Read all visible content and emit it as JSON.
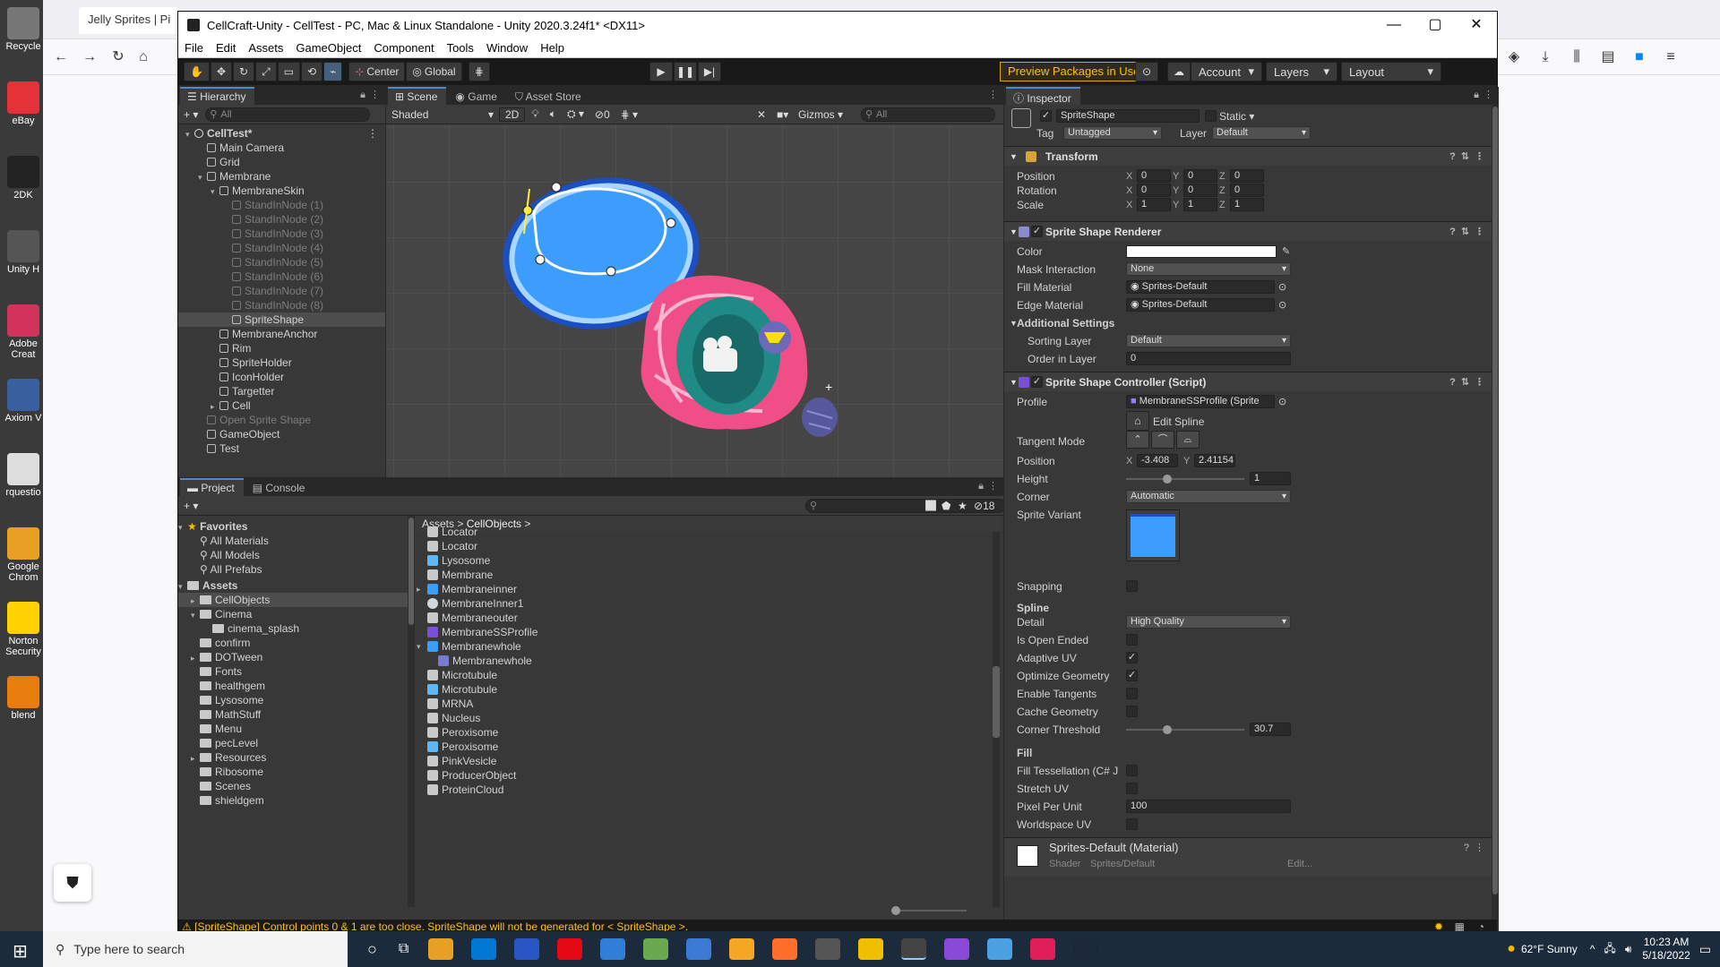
{
  "desktop": {
    "icons": [
      "Recycle",
      "eBay",
      "2DK",
      "Unity H",
      "Adobe Creat",
      "Axiom V",
      "rquestio",
      "Google Chrom",
      "Norton Security",
      "blend"
    ]
  },
  "browser": {
    "tab_title": "Jelly Sprites | Pi",
    "nav": {
      "back": "←",
      "forward": "→",
      "reload": "↻",
      "home": "⌂"
    }
  },
  "unity": {
    "title": "CellCraft-Unity - CellTest - PC, Mac & Linux Standalone - Unity 2020.3.24f1* <DX11>",
    "menu": [
      "File",
      "Edit",
      "Assets",
      "GameObject",
      "Component",
      "Tools",
      "Window",
      "Help"
    ],
    "toolbar": {
      "center": "Center",
      "global": "Global",
      "preview": "Preview Packages in Use",
      "account": "Account",
      "layers": "Layers",
      "layout": "Layout"
    },
    "hierarchy": {
      "tab": "Hierarchy",
      "search_placeholder": "All",
      "rows": [
        {
          "label": "CellTest*",
          "indent": 0,
          "arrow": "▾",
          "dim": false,
          "bold": true
        },
        {
          "label": "Main Camera",
          "indent": 1,
          "arrow": "",
          "dim": false
        },
        {
          "label": "Grid",
          "indent": 1,
          "arrow": "",
          "dim": false
        },
        {
          "label": "Membrane",
          "indent": 1,
          "arrow": "▾",
          "dim": false
        },
        {
          "label": "MembraneSkin",
          "indent": 2,
          "arrow": "▾",
          "dim": false
        },
        {
          "label": "StandInNode (1)",
          "indent": 3,
          "arrow": "",
          "dim": true
        },
        {
          "label": "StandInNode (2)",
          "indent": 3,
          "arrow": "",
          "dim": true
        },
        {
          "label": "StandInNode (3)",
          "indent": 3,
          "arrow": "",
          "dim": true
        },
        {
          "label": "StandInNode (4)",
          "indent": 3,
          "arrow": "",
          "dim": true
        },
        {
          "label": "StandInNode (5)",
          "indent": 3,
          "arrow": "",
          "dim": true
        },
        {
          "label": "StandInNode (6)",
          "indent": 3,
          "arrow": "",
          "dim": true
        },
        {
          "label": "StandInNode (7)",
          "indent": 3,
          "arrow": "",
          "dim": true
        },
        {
          "label": "StandInNode (8)",
          "indent": 3,
          "arrow": "",
          "dim": true
        },
        {
          "label": "SpriteShape",
          "indent": 3,
          "arrow": "",
          "dim": false,
          "selected": true
        },
        {
          "label": "MembraneAnchor",
          "indent": 2,
          "arrow": "",
          "dim": false
        },
        {
          "label": "Rim",
          "indent": 2,
          "arrow": "",
          "dim": false
        },
        {
          "label": "SpriteHolder",
          "indent": 2,
          "arrow": "",
          "dim": false
        },
        {
          "label": "IconHolder",
          "indent": 2,
          "arrow": "",
          "dim": false
        },
        {
          "label": "Targetter",
          "indent": 2,
          "arrow": "",
          "dim": false
        },
        {
          "label": "Cell",
          "indent": 2,
          "arrow": "▸",
          "dim": false
        },
        {
          "label": "Open Sprite Shape",
          "indent": 1,
          "arrow": "",
          "dim": true
        },
        {
          "label": "GameObject",
          "indent": 1,
          "arrow": "",
          "dim": false
        },
        {
          "label": "Test",
          "indent": 1,
          "arrow": "",
          "dim": false
        }
      ]
    },
    "scene": {
      "tabs": [
        "Scene",
        "Game",
        "Asset Store"
      ],
      "shading": "Shaded",
      "mode_2d": "2D",
      "hidden_count": "0",
      "gizmos": "Gizmos",
      "search_placeholder": "All"
    },
    "inspector": {
      "tab": "Inspector",
      "object_name": "SpriteShape",
      "static_label": "Static",
      "tag_label": "Tag",
      "tag_value": "Untagged",
      "layer_label": "Layer",
      "layer_value": "Default",
      "transform": {
        "title": "Transform",
        "rows": [
          {
            "label": "Position",
            "x": "0",
            "y": "0",
            "z": "0"
          },
          {
            "label": "Rotation",
            "x": "0",
            "y": "0",
            "z": "0"
          },
          {
            "label": "Scale",
            "x": "1",
            "y": "1",
            "z": "1"
          }
        ]
      },
      "renderer": {
        "title": "Sprite Shape Renderer",
        "color_label": "Color",
        "mask_label": "Mask Interaction",
        "mask_value": "None",
        "fill_label": "Fill Material",
        "fill_value": "Sprites-Default",
        "edge_label": "Edge Material",
        "edge_value": "Sprites-Default",
        "additional": "Additional Settings",
        "sorting_label": "Sorting Layer",
        "sorting_value": "Default",
        "order_label": "Order in Layer",
        "order_value": "0"
      },
      "controller": {
        "title": "Sprite Shape Controller (Script)",
        "profile_label": "Profile",
        "profile_value": "MembraneSSProfile (Sprite",
        "edit_spline": "Edit Spline",
        "tangent_label": "Tangent Mode",
        "position_label": "Position",
        "pos_x": "-3.408",
        "pos_y": "2.41154",
        "height_label": "Height",
        "height_value": "1",
        "height_slider": 0.35,
        "corner_label": "Corner",
        "corner_value": "Automatic",
        "variant_label": "Sprite Variant",
        "snapping_label": "Snapping",
        "spline_header": "Spline",
        "detail_label": "Detail",
        "detail_value": "High Quality",
        "open_ended_label": "Is Open Ended",
        "adaptive_label": "Adaptive UV",
        "optimize_label": "Optimize Geometry",
        "tangents_label": "Enable Tangents",
        "cache_label": "Cache Geometry",
        "threshold_label": "Corner Threshold",
        "threshold_value": "30.7",
        "threshold_slider": 0.35,
        "fill_header": "Fill",
        "tessellation_label": "Fill Tessellation (C# J",
        "stretch_label": "Stretch UV",
        "ppu_label": "Pixel Per Unit",
        "ppu_value": "100",
        "worldspace_label": "Worldspace UV",
        "checks": {
          "snapping": false,
          "open_ended": false,
          "adaptive": true,
          "optimize": true,
          "tangents": false,
          "cache": false,
          "tessellation": false,
          "stretch": false,
          "worldspace": false
        }
      },
      "material": {
        "title": "Sprites-Default (Material)",
        "shader_label": "Shader",
        "shader_value": "Sprites/Default",
        "edit": "Edit..."
      }
    },
    "project": {
      "tabs": [
        "Project",
        "Console"
      ],
      "hidden_count": "18",
      "favorites": {
        "label": "Favorites",
        "items": [
          "All Materials",
          "All Models",
          "All Prefabs"
        ]
      },
      "assets_label": "Assets",
      "folders": [
        {
          "label": "CellObjects",
          "indent": 1,
          "arrow": "▸",
          "selected": true
        },
        {
          "label": "Cinema",
          "indent": 1,
          "arrow": "▾"
        },
        {
          "label": "cinema_splash",
          "indent": 2,
          "arrow": ""
        },
        {
          "label": "confirm",
          "indent": 1,
          "arrow": ""
        },
        {
          "label": "DOTween",
          "indent": 1,
          "arrow": "▸"
        },
        {
          "label": "Fonts",
          "indent": 1,
          "arrow": ""
        },
        {
          "label": "healthgem",
          "indent": 1,
          "arrow": ""
        },
        {
          "label": "Lysosome",
          "indent": 1,
          "arrow": ""
        },
        {
          "label": "MathStuff",
          "indent": 1,
          "arrow": ""
        },
        {
          "label": "Menu",
          "indent": 1,
          "arrow": ""
        },
        {
          "label": "pecLevel",
          "indent": 1,
          "arrow": ""
        },
        {
          "label": "Resources",
          "indent": 1,
          "arrow": "▸"
        },
        {
          "label": "Ribosome",
          "indent": 1,
          "arrow": ""
        },
        {
          "label": "Scenes",
          "indent": 1,
          "arrow": ""
        },
        {
          "label": "shieldgem",
          "indent": 1,
          "arrow": ""
        }
      ],
      "breadcrumb": [
        "Assets",
        "CellObjects"
      ],
      "files": [
        {
          "label": "Locator",
          "kind": "script",
          "indent": 0
        },
        {
          "label": "Locator",
          "kind": "script",
          "indent": 0
        },
        {
          "label": "Lysosome",
          "kind": "prefab",
          "indent": 0
        },
        {
          "label": "Membrane",
          "kind": "script",
          "indent": 0
        },
        {
          "label": "Membraneinner",
          "kind": "sprite",
          "indent": 0,
          "arrow": "▸"
        },
        {
          "label": "MembraneInner1",
          "kind": "material",
          "indent": 0
        },
        {
          "label": "Membraneouter",
          "kind": "script",
          "indent": 0
        },
        {
          "label": "MembraneSSProfile",
          "kind": "profile",
          "indent": 0
        },
        {
          "label": "Membranewhole",
          "kind": "sprite",
          "indent": 0,
          "arrow": "▾"
        },
        {
          "label": "Membranewhole",
          "kind": "subsprite",
          "indent": 1
        },
        {
          "label": "Microtubule",
          "kind": "script",
          "indent": 0
        },
        {
          "label": "Microtubule",
          "kind": "prefab",
          "indent": 0
        },
        {
          "label": "MRNA",
          "kind": "script",
          "indent": 0
        },
        {
          "label": "Nucleus",
          "kind": "script",
          "indent": 0
        },
        {
          "label": "Peroxisome",
          "kind": "script",
          "indent": 0
        },
        {
          "label": "Peroxisome",
          "kind": "prefab",
          "indent": 0
        },
        {
          "label": "PinkVesicle",
          "kind": "script",
          "indent": 0
        },
        {
          "label": "ProducerObject",
          "kind": "script",
          "indent": 0
        },
        {
          "label": "ProteinCloud",
          "kind": "script",
          "indent": 0
        }
      ]
    },
    "status": "[SpriteShape] Control points 0 & 1 are too close. SpriteShape will not be generated for < SpriteShape >."
  },
  "taskbar": {
    "search_placeholder": "Type here to search",
    "weather": "62°F  Sunny",
    "time": "10:23 AM",
    "date": "5/18/2022"
  },
  "colors": {
    "membrane_blue": "#3d9dfc",
    "membrane_pink": "#ef4f86",
    "nucleus_teal": "#1f8a86",
    "warning": "#ffc107"
  }
}
